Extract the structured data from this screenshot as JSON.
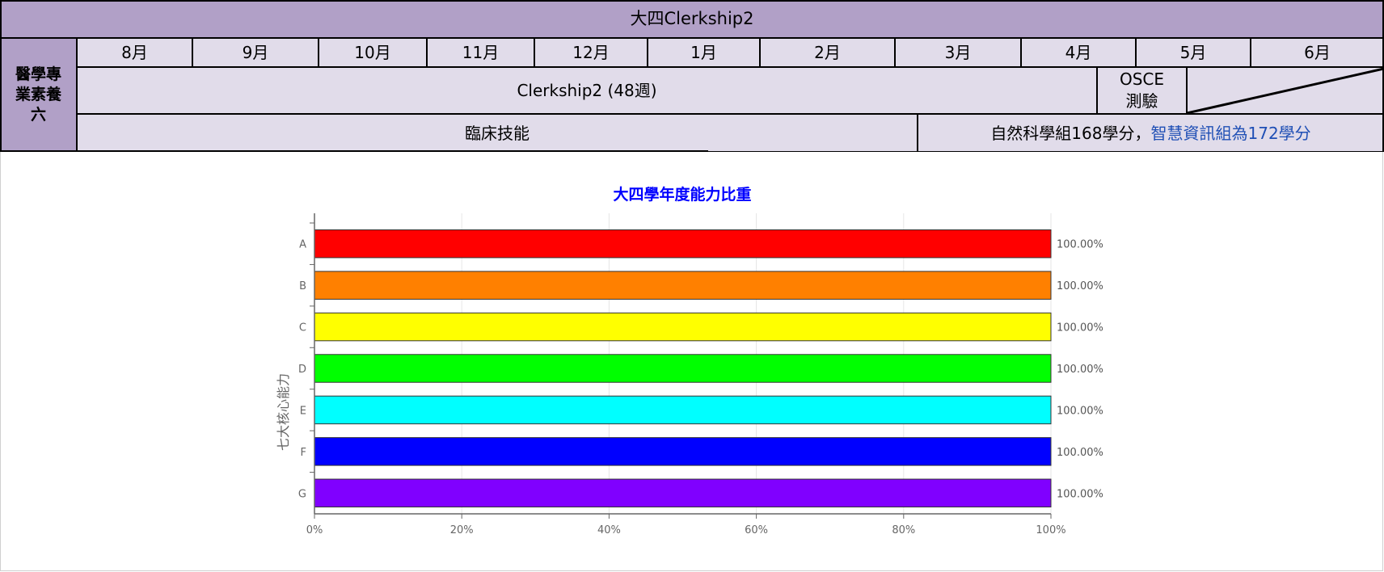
{
  "header": {
    "title": "大四Clerkship2"
  },
  "row_label": "醫學專\n業素養\n六",
  "months": [
    "8月",
    "9月",
    "10月",
    "11月",
    "12月",
    "1月",
    "2月",
    "3月",
    "4月",
    "5月",
    "6月"
  ],
  "clerkship": {
    "label": "Clerkship2 (48週)",
    "osce": "OSCE\n測驗"
  },
  "skills": {
    "label": "臨床技能",
    "credits_part1": "自然科學組168學分，",
    "credits_part2": "智慧資訊組為172學分"
  },
  "chart_data": {
    "type": "bar",
    "orientation": "horizontal",
    "title": "大四學年度能力比重",
    "ylabel": "七大核心能力",
    "xlabel": "",
    "categories": [
      "A",
      "B",
      "C",
      "D",
      "E",
      "F",
      "G"
    ],
    "values": [
      100,
      100,
      100,
      100,
      100,
      100,
      100
    ],
    "value_labels": [
      "100.00%",
      "100.00%",
      "100.00%",
      "100.00%",
      "100.00%",
      "100.00%",
      "100.00%"
    ],
    "colors": [
      "#ff0000",
      "#ff8000",
      "#ffff00",
      "#00ff00",
      "#00ffff",
      "#0000ff",
      "#8000ff"
    ],
    "xlim": [
      0,
      100
    ],
    "xticks": [
      "0%",
      "20%",
      "40%",
      "60%",
      "80%",
      "100%"
    ],
    "title_color": "#0000ff",
    "grid": true
  }
}
